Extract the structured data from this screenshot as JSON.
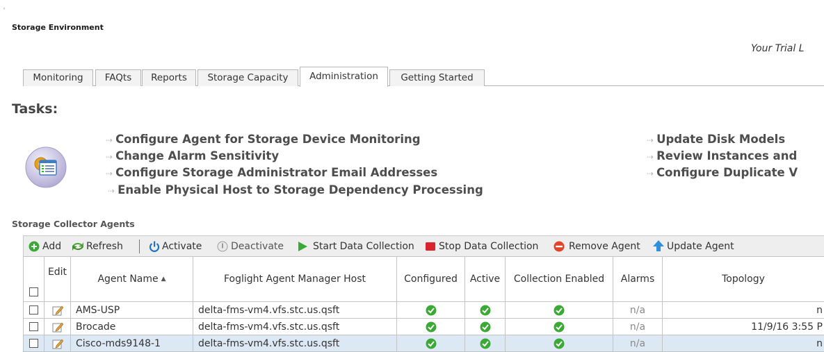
{
  "corner_mark": "°",
  "page_title": "Storage Environment",
  "trial_text": "Your Trial L",
  "tabs": [
    {
      "label": "Monitoring",
      "active": false
    },
    {
      "label": "FAQts",
      "active": false
    },
    {
      "label": "Reports",
      "active": false
    },
    {
      "label": "Storage Capacity",
      "active": false
    },
    {
      "label": "Administration",
      "active": true
    },
    {
      "label": "Getting Started",
      "active": false
    }
  ],
  "tasks": {
    "heading": "Tasks:",
    "left": [
      "Configure Agent for Storage Device Monitoring",
      "Change Alarm Sensitivity",
      "Configure Storage Administrator Email Addresses",
      "Enable Physical Host to Storage Dependency Processing"
    ],
    "right": [
      "Update Disk Models",
      "Review Instances and",
      "Configure Duplicate V"
    ]
  },
  "collector": {
    "title": "Storage Collector Agents",
    "toolbar": {
      "add": "Add",
      "refresh": "Refresh",
      "activate": "Activate",
      "deactivate": "Deactivate",
      "start": "Start Data Collection",
      "stop": "Stop Data Collection",
      "remove": "Remove Agent",
      "update": "Update Agent"
    },
    "columns": {
      "edit": "Edit",
      "agent_name": "Agent Name",
      "host": "Foglight Agent Manager Host",
      "configured": "Configured",
      "active": "Active",
      "collection_enabled": "Collection Enabled",
      "alarms": "Alarms",
      "topology": "Topology"
    },
    "rows": [
      {
        "name": "AMS-USP",
        "host": "delta-fms-vm4.vfs.stc.us.qsft",
        "alarms": "n/a",
        "topology": "n"
      },
      {
        "name": "Brocade",
        "host": "delta-fms-vm4.vfs.stc.us.qsft",
        "alarms": "n/a",
        "topology": "11/9/16 3:55 P"
      },
      {
        "name": "Cisco-mds9148-1",
        "host": "delta-fms-vm4.vfs.stc.us.qsft",
        "alarms": "n/a",
        "topology": "n"
      }
    ]
  },
  "colors": {
    "check_green": "#3aa935",
    "task_text": "#4d4d4d",
    "selected_row": "#dde8f5"
  },
  "icons": {
    "add": "add-icon",
    "refresh": "refresh-icon",
    "activate": "power-icon",
    "deactivate": "power-disabled-icon",
    "start": "play-icon",
    "stop": "stop-icon",
    "remove": "remove-icon",
    "update": "up-arrow-icon",
    "edit": "pencil-icon",
    "status": "check-icon"
  }
}
